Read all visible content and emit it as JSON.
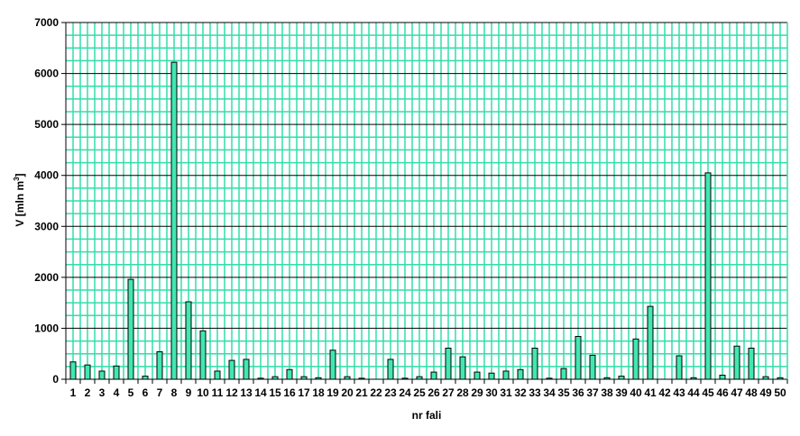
{
  "chart_data": {
    "type": "bar",
    "title": "",
    "xlabel": "nr fali",
    "ylabel_main": "V [mln m",
    "ylabel_sup": "3",
    "ylabel_close": "]",
    "ylim": [
      0,
      7000
    ],
    "yticks": [
      "0",
      "1000",
      "2000",
      "3000",
      "4000",
      "5000",
      "6000",
      "7000"
    ],
    "grid": true,
    "legend": "none",
    "categories": [
      "1",
      "2",
      "3",
      "4",
      "5",
      "6",
      "7",
      "8",
      "9",
      "10",
      "11",
      "12",
      "13",
      "14",
      "15",
      "16",
      "17",
      "18",
      "19",
      "20",
      "21",
      "22",
      "23",
      "24",
      "25",
      "26",
      "27",
      "28",
      "29",
      "30",
      "31",
      "32",
      "33",
      "34",
      "35",
      "36",
      "37",
      "38",
      "39",
      "40",
      "41",
      "42",
      "43",
      "44",
      "45",
      "46",
      "47",
      "48",
      "49",
      "50"
    ],
    "values": [
      340,
      280,
      160,
      260,
      1960,
      60,
      540,
      6220,
      1520,
      950,
      160,
      370,
      390,
      20,
      50,
      190,
      50,
      30,
      570,
      50,
      20,
      0,
      390,
      20,
      50,
      140,
      610,
      440,
      140,
      120,
      160,
      190,
      610,
      20,
      210,
      840,
      470,
      30,
      60,
      790,
      1430,
      0,
      460,
      30,
      4050,
      80,
      650,
      610,
      50,
      30
    ],
    "colors": {
      "bar_fill": "#40e8b0",
      "bar_stroke": "#000000",
      "grid_major": "#000000",
      "grid_minor": "#33ddaa",
      "plot_bg": "#ffffff"
    }
  }
}
